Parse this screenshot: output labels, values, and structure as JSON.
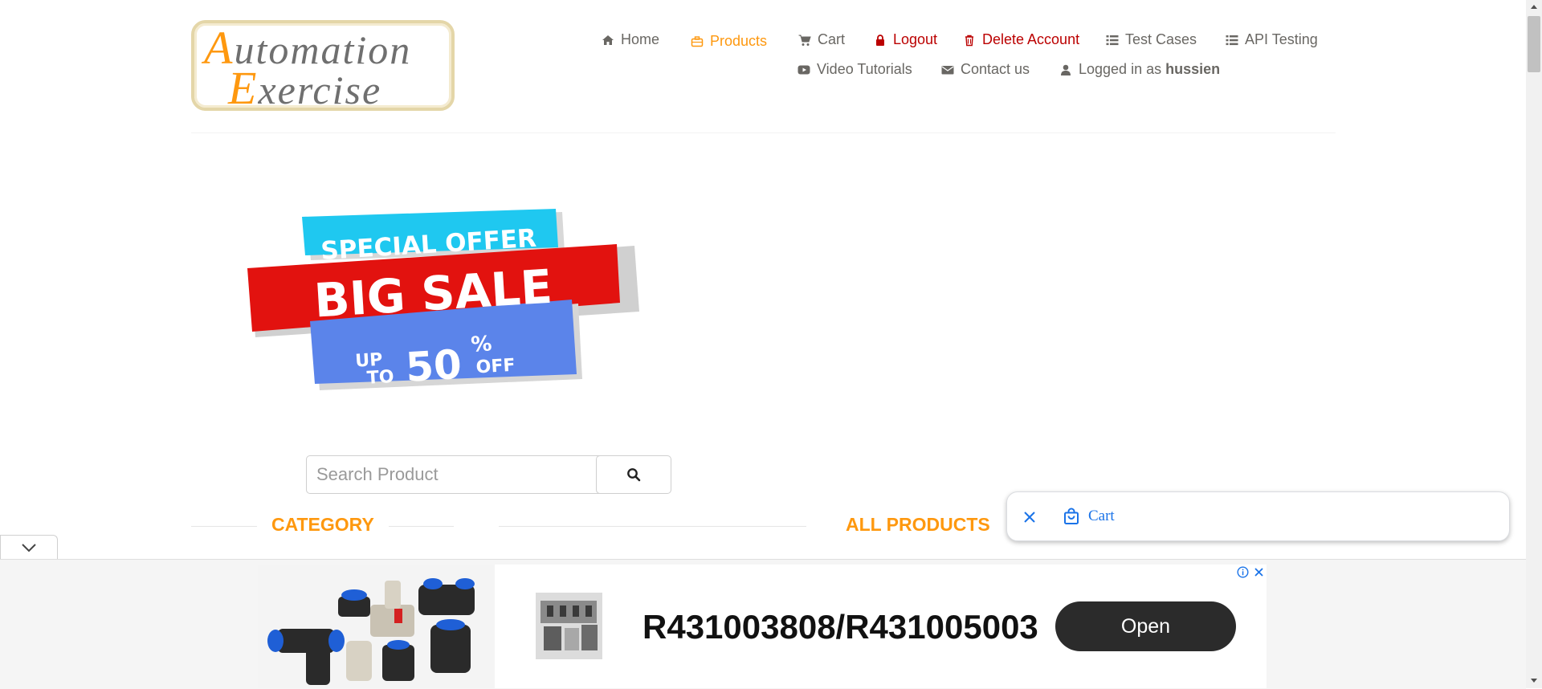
{
  "header": {
    "logo_text_line1": "Automation",
    "logo_text_line2": "Exercise"
  },
  "nav": {
    "home": "Home",
    "products": "Products",
    "cart": "Cart",
    "logout": "Logout",
    "delete_account": "Delete Account",
    "test_cases": "Test Cases",
    "api_testing": "API Testing",
    "video_tutorials": "Video Tutorials",
    "contact_us": "Contact us",
    "logged_in_prefix": "Logged in as",
    "username": "hussien"
  },
  "banner": {
    "line1": "SPECIAL OFFER",
    "line2": "BIG SALE",
    "up": "UP",
    "to": "TO",
    "percent_value": "50",
    "percent_sign": "%",
    "off": "OFF"
  },
  "search": {
    "placeholder": "Search Product",
    "value": ""
  },
  "sections": {
    "category": "CATEGORY",
    "all_products": "ALL PRODUCTS"
  },
  "floating_cart": {
    "label": "Cart"
  },
  "ad": {
    "title": "R431003808/R431005003",
    "button_label": "Open"
  },
  "colors": {
    "accent": "#fe980f",
    "danger": "#b00000",
    "link_blue": "#1a73e8",
    "banner_cyan": "#1fc8f0",
    "banner_red": "#e2120f",
    "banner_blue": "#5b84ea"
  },
  "icons": {
    "home": "home-icon",
    "products": "briefcase-icon",
    "cart": "shopping-cart-icon",
    "logout": "lock-icon",
    "delete": "trash-icon",
    "test_cases": "list-icon",
    "api": "list-icon",
    "video": "youtube-play-icon",
    "contact": "envelope-icon",
    "user": "user-icon",
    "search": "search-icon",
    "close": "close-icon",
    "bag": "shopping-bag-icon",
    "collapse": "chevron-down-icon",
    "info": "info-icon"
  }
}
